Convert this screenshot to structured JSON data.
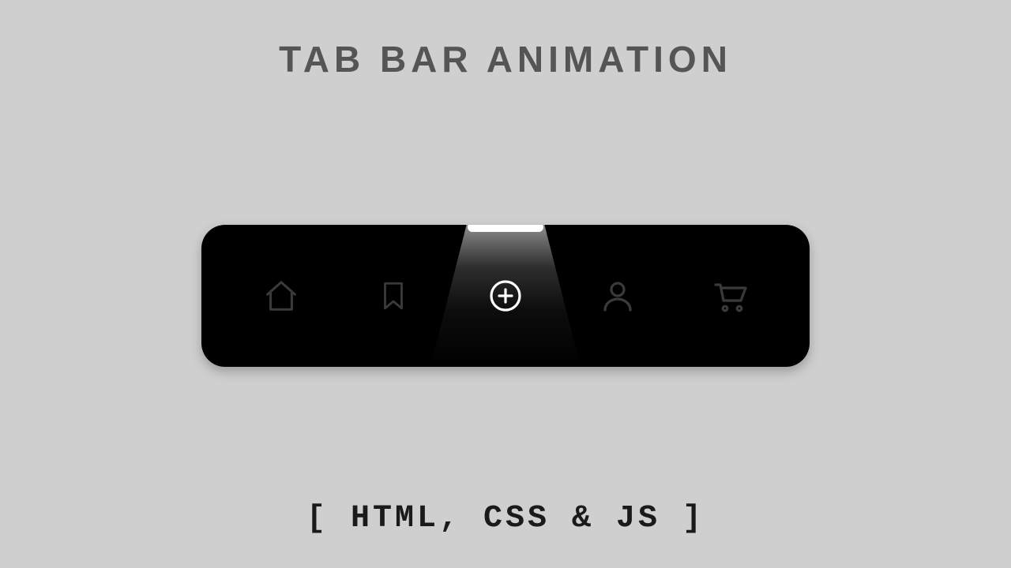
{
  "title": "TAB BAR  ANIMATION",
  "subtitle": "[ HTML, CSS & JS ]",
  "colors": {
    "background": "#cfcfcf",
    "bar": "#000000",
    "icon_inactive": "#3a3a3a",
    "icon_active": "#ffffff",
    "title": "#555555",
    "subtitle": "#1a1a1a"
  },
  "tabbar": {
    "active_index": 2,
    "items": [
      {
        "name": "home",
        "icon": "home-icon"
      },
      {
        "name": "bookmark",
        "icon": "bookmark-icon"
      },
      {
        "name": "add",
        "icon": "plus-circle-icon"
      },
      {
        "name": "profile",
        "icon": "user-icon"
      },
      {
        "name": "cart",
        "icon": "cart-icon"
      }
    ]
  }
}
